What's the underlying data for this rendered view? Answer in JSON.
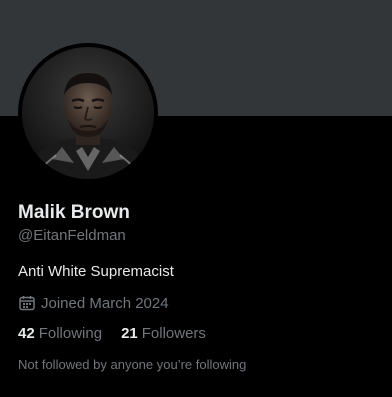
{
  "profile": {
    "display_name": "Malik Brown",
    "handle": "@EitanFeldman",
    "bio": "Anti White Supremacist",
    "joined": "Joined March 2024",
    "following_count": "42",
    "following_label": "Following",
    "followers_count": "21",
    "followers_label": "Followers",
    "mutuals_note": "Not followed by anyone you’re following"
  },
  "icons": {
    "joined": "calendar-icon"
  },
  "colors": {
    "background": "#000000",
    "banner": "#333639",
    "primary_text": "#e7e9ea",
    "secondary_text": "#71767b"
  }
}
